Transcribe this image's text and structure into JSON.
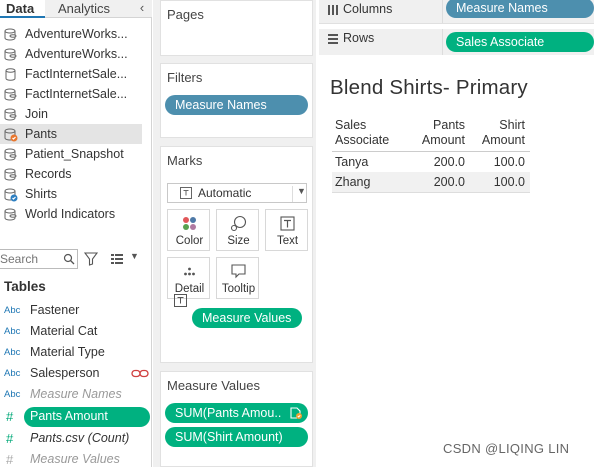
{
  "left_pane": {
    "tabs": {
      "data": "Data",
      "analytics": "Analytics",
      "collapse": "‹"
    },
    "datasources": [
      {
        "label": "AdventureWorks...",
        "icon": "datasource-icon"
      },
      {
        "label": "AdventureWorks...",
        "icon": "datasource-icon"
      },
      {
        "label": "FactInternetSale...",
        "icon": "database-icon"
      },
      {
        "label": "FactInternetSale...",
        "icon": "datasource-icon"
      },
      {
        "label": "Join",
        "icon": "datasource-icon"
      },
      {
        "label": "Pants",
        "icon": "datasource-secondary-icon",
        "selected": true
      },
      {
        "label": "Patient_Snapshot",
        "icon": "datasource-icon"
      },
      {
        "label": "Records",
        "icon": "datasource-icon"
      },
      {
        "label": "Shirts",
        "icon": "datasource-primary-icon"
      },
      {
        "label": "World Indicators",
        "icon": "datasource-icon"
      }
    ],
    "search": {
      "placeholder": "Search"
    },
    "tables_heading": "Tables",
    "fields": [
      {
        "type": "Abc",
        "label": "Fastener"
      },
      {
        "type": "Abc",
        "label": "Material Cat"
      },
      {
        "type": "Abc",
        "label": "Material Type"
      },
      {
        "type": "Abc",
        "label": "Salesperson",
        "linked": true
      },
      {
        "type": "Abc",
        "label": "Measure Names",
        "italic": true
      },
      {
        "type": "#",
        "label": "Pants Amount",
        "selected": true
      },
      {
        "type": "#",
        "label": "Pants.csv (Count)",
        "italic": true
      },
      {
        "type": "#",
        "label": "Measure Values",
        "italic": true
      }
    ]
  },
  "cards": {
    "pages": {
      "title": "Pages"
    },
    "filters": {
      "title": "Filters",
      "pill": "Measure Names"
    },
    "marks": {
      "title": "Marks",
      "type": "Automatic",
      "buttons": {
        "color": "Color",
        "size": "Size",
        "text": "Text",
        "detail": "Detail",
        "tooltip": "Tooltip"
      },
      "text_pill": "Measure Values"
    },
    "measure_values": {
      "title": "Measure Values",
      "pills": [
        "SUM(Pants Amou..",
        "SUM(Shirt Amount)"
      ]
    }
  },
  "shelves": {
    "columns": {
      "label": "Columns",
      "pill": "Measure Names"
    },
    "rows": {
      "label": "Rows",
      "pill": "Sales Associate"
    }
  },
  "sheet": {
    "title": "Blend Shirts- Primary",
    "headers": {
      "col1_line1": "Sales",
      "col1_line2": "Associate",
      "col2_line1": "Pants",
      "col2_line2": "Amount",
      "col3_line1": "Shirt",
      "col3_line2": "Amount"
    },
    "rows": [
      {
        "associate": "Tanya",
        "pants": "200.0",
        "shirt": "100.0"
      },
      {
        "associate": "Zhang",
        "pants": "200.0",
        "shirt": "100.0"
      }
    ]
  },
  "watermark": "CSDN @LIQING LIN",
  "colors": {
    "pill_blue": "#4d8fae",
    "pill_green": "#00b180",
    "accent": "#1f77b4"
  }
}
